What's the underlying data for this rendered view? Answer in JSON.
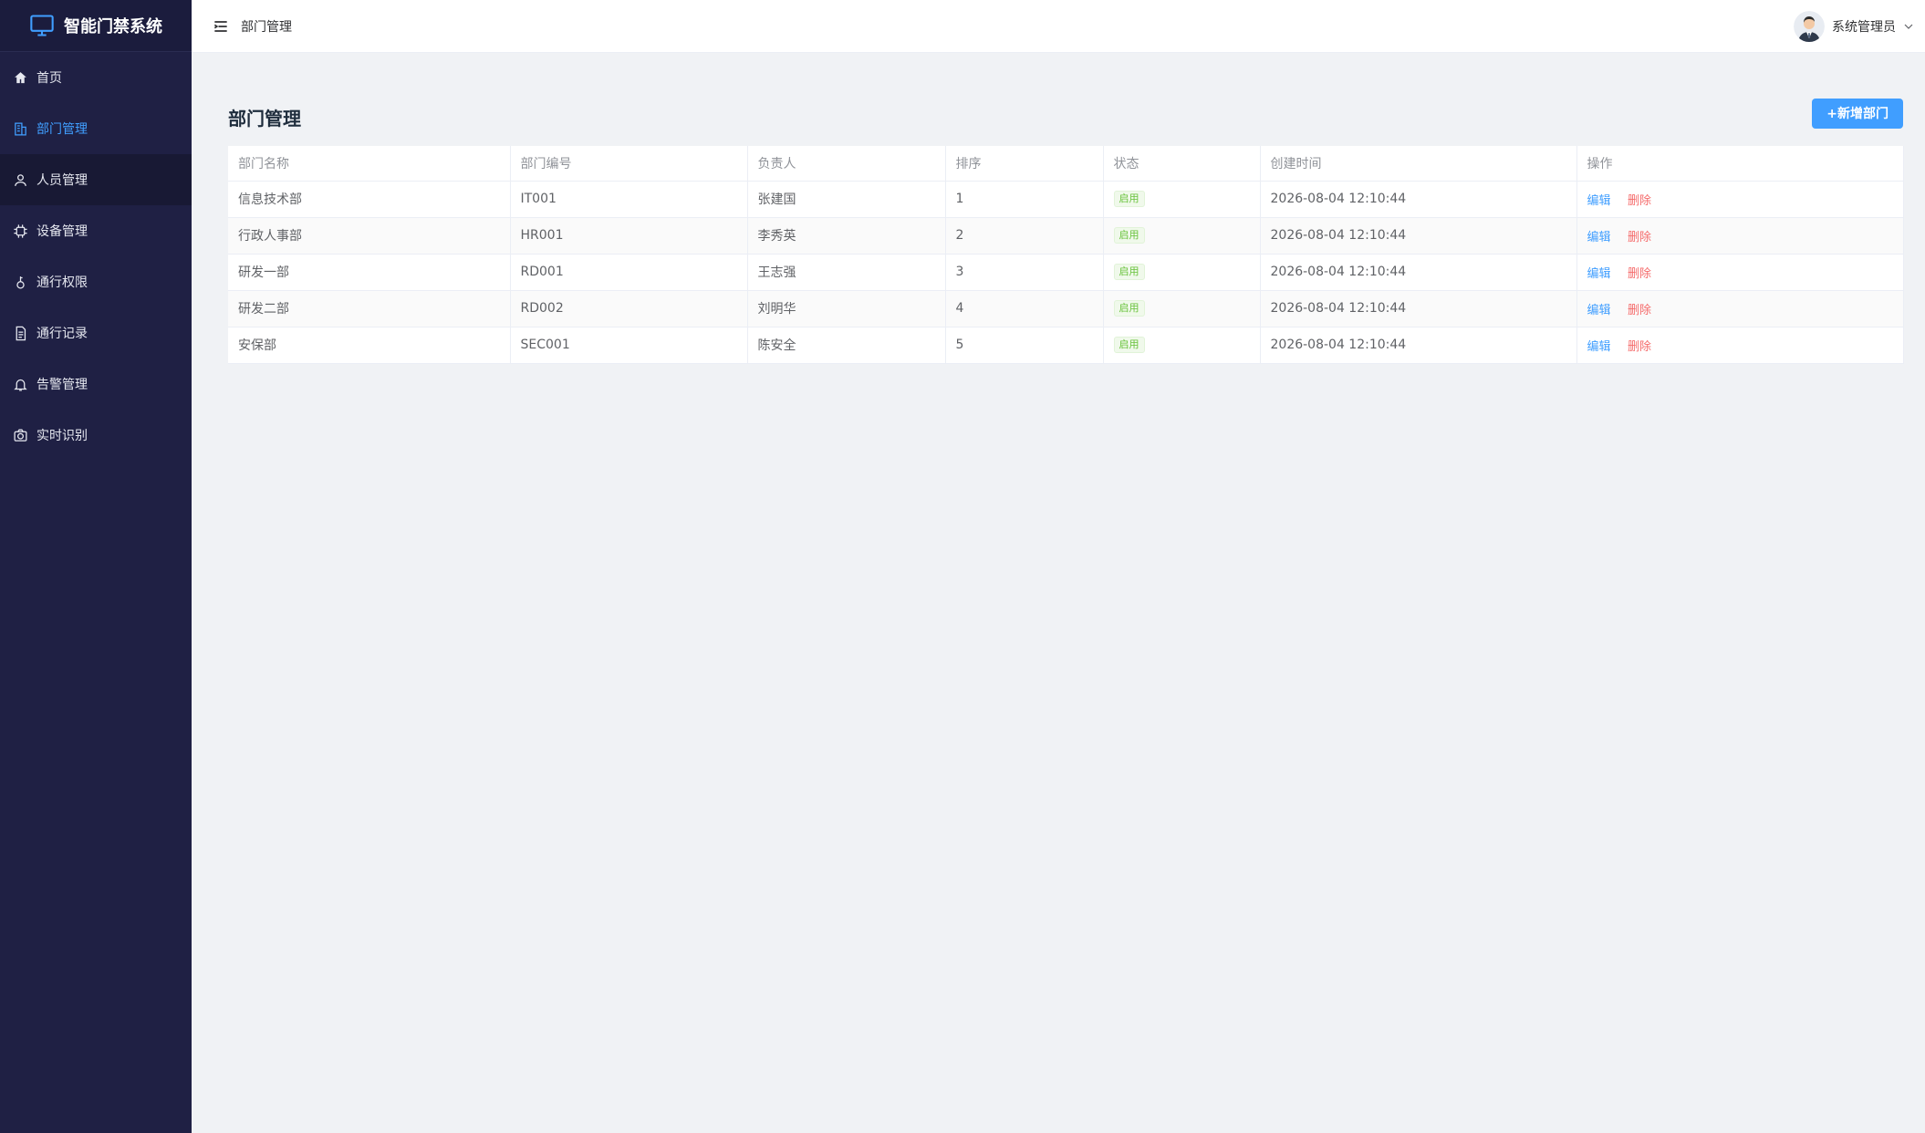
{
  "app": {
    "title": "智能门禁系统"
  },
  "sidebar": {
    "items": [
      {
        "label": "首页",
        "icon": "home-icon"
      },
      {
        "label": "部门管理",
        "icon": "building-icon"
      },
      {
        "label": "人员管理",
        "icon": "user-icon"
      },
      {
        "label": "设备管理",
        "icon": "chip-icon"
      },
      {
        "label": "通行权限",
        "icon": "key-icon"
      },
      {
        "label": "通行记录",
        "icon": "document-icon"
      },
      {
        "label": "告警管理",
        "icon": "bell-icon"
      },
      {
        "label": "实时识别",
        "icon": "camera-icon"
      }
    ]
  },
  "header": {
    "breadcrumb": "部门管理",
    "user_name": "系统管理员"
  },
  "page": {
    "title": "部门管理",
    "add_button": "+新增部门"
  },
  "table": {
    "columns": [
      "部门名称",
      "部门编号",
      "负责人",
      "排序",
      "状态",
      "创建时间",
      "操作"
    ],
    "edit_label": "编辑",
    "delete_label": "删除",
    "rows": [
      {
        "name": "信息技术部",
        "code": "IT001",
        "leader": "张建国",
        "sort": "1",
        "status": "启用",
        "created": "2026-08-04 12:10:44"
      },
      {
        "name": "行政人事部",
        "code": "HR001",
        "leader": "李秀英",
        "sort": "2",
        "status": "启用",
        "created": "2026-08-04 12:10:44"
      },
      {
        "name": "研发一部",
        "code": "RD001",
        "leader": "王志强",
        "sort": "3",
        "status": "启用",
        "created": "2026-08-04 12:10:44"
      },
      {
        "name": "研发二部",
        "code": "RD002",
        "leader": "刘明华",
        "sort": "4",
        "status": "启用",
        "created": "2026-08-04 12:10:44"
      },
      {
        "name": "安保部",
        "code": "SEC001",
        "leader": "陈安全",
        "sort": "5",
        "status": "启用",
        "created": "2026-08-04 12:10:44"
      }
    ]
  },
  "colors": {
    "sidebar_bg": "#1f2044",
    "accent": "#409eff",
    "success": "#67c23a",
    "danger": "#f56c6c"
  }
}
